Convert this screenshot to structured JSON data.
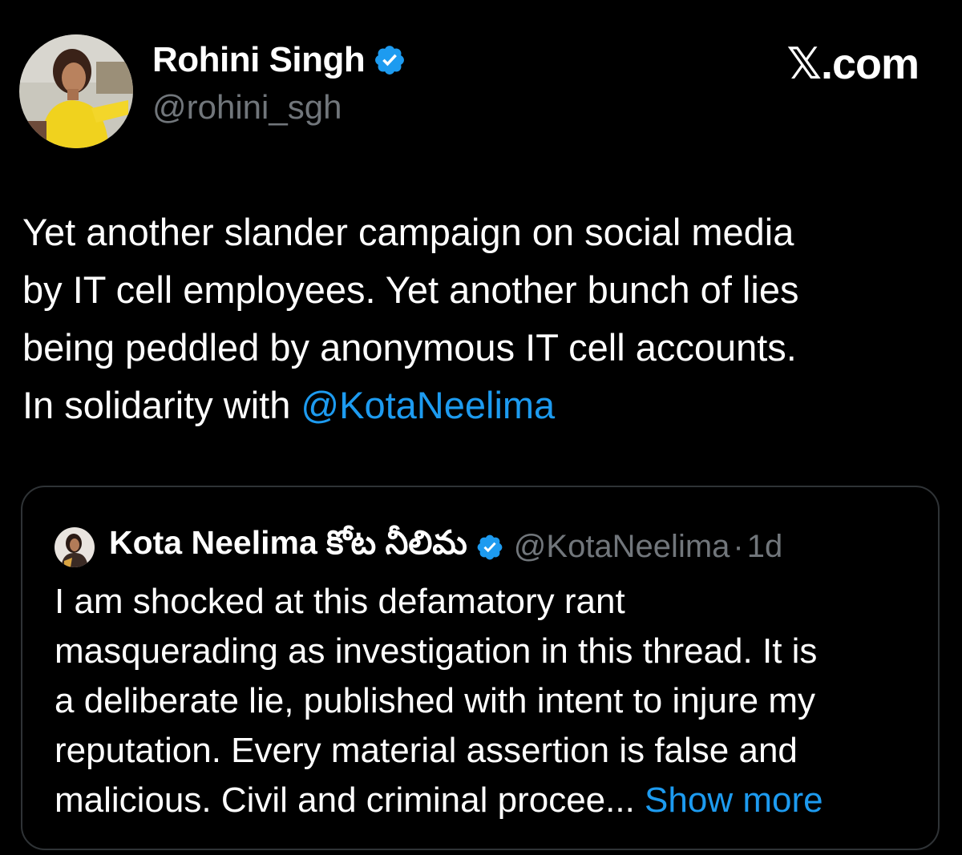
{
  "watermark": "𝕏.com",
  "author": {
    "name": "Rohini Singh",
    "handle": "@rohini_sgh",
    "verified": true
  },
  "tweet": {
    "lines": [
      "Yet another slander campaign on social media",
      "by IT cell employees. Yet another bunch of lies",
      "being peddled by anonymous IT cell accounts.",
      "In solidarity with "
    ],
    "mention": "@KotaNeelima"
  },
  "quote": {
    "name": "Kota Neelima కోట నీలిమ",
    "verified": true,
    "handle": "@KotaNeelima",
    "separator": "·",
    "time": "1d",
    "lines": [
      "I am shocked at this defamatory rant",
      "masquerading as investigation in this thread. It is",
      "a deliberate lie, published with intent to injure my",
      "reputation. Every material assertion is false and",
      "malicious. Civil and criminal procee..."
    ],
    "show_more": " Show more"
  },
  "colors": {
    "background": "#000000",
    "text": "#ffffff",
    "secondary": "#71767b",
    "link": "#1d9bf0",
    "border": "#2f3336"
  },
  "icons": {
    "verified": "verified-badge-icon",
    "author_avatar": "avatar",
    "quote_avatar": "avatar"
  }
}
